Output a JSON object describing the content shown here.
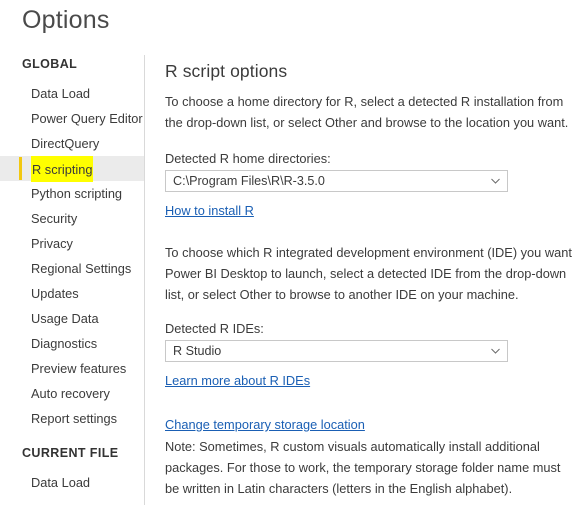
{
  "dialog": {
    "title": "Options"
  },
  "sidebar": {
    "groups": [
      {
        "header": "GLOBAL",
        "items": [
          {
            "label": "Data Load",
            "selected": false
          },
          {
            "label": "Power Query Editor",
            "selected": false
          },
          {
            "label": "DirectQuery",
            "selected": false
          },
          {
            "label": "R scripting",
            "selected": true
          },
          {
            "label": "Python scripting",
            "selected": false
          },
          {
            "label": "Security",
            "selected": false
          },
          {
            "label": "Privacy",
            "selected": false
          },
          {
            "label": "Regional Settings",
            "selected": false
          },
          {
            "label": "Updates",
            "selected": false
          },
          {
            "label": "Usage Data",
            "selected": false
          },
          {
            "label": "Diagnostics",
            "selected": false
          },
          {
            "label": "Preview features",
            "selected": false
          },
          {
            "label": "Auto recovery",
            "selected": false
          },
          {
            "label": "Report settings",
            "selected": false
          }
        ]
      },
      {
        "header": "CURRENT FILE",
        "items": [
          {
            "label": "Data Load",
            "selected": false
          }
        ]
      }
    ]
  },
  "content": {
    "section_title": "R script options",
    "home_dir_description": "To choose a home directory for R, select a detected R installation from the drop-down list, or select Other and browse to the location you want.",
    "home_dir_label": "Detected R home directories:",
    "home_dir_value": "C:\\Program Files\\R\\R-3.5.0",
    "install_link": "How to install R",
    "ide_description": "To choose which R integrated development environment (IDE) you want Power BI Desktop to launch, select a detected IDE from the drop-down list, or select Other to browse to another IDE on your machine.",
    "ide_label": "Detected R IDEs:",
    "ide_value": "R Studio",
    "ide_link": "Learn more about R IDEs",
    "storage_link": "Change temporary storage location",
    "storage_note": "Note: Sometimes, R custom visuals automatically install additional packages. For those to work, the temporary storage folder name must be written in Latin characters (letters in the English alphabet)."
  },
  "colors": {
    "accent_gold": "#f2c811",
    "highlight_yellow": "#ffff00",
    "link_blue": "#1a5fb4",
    "selected_row_bg": "#ebebeb"
  }
}
